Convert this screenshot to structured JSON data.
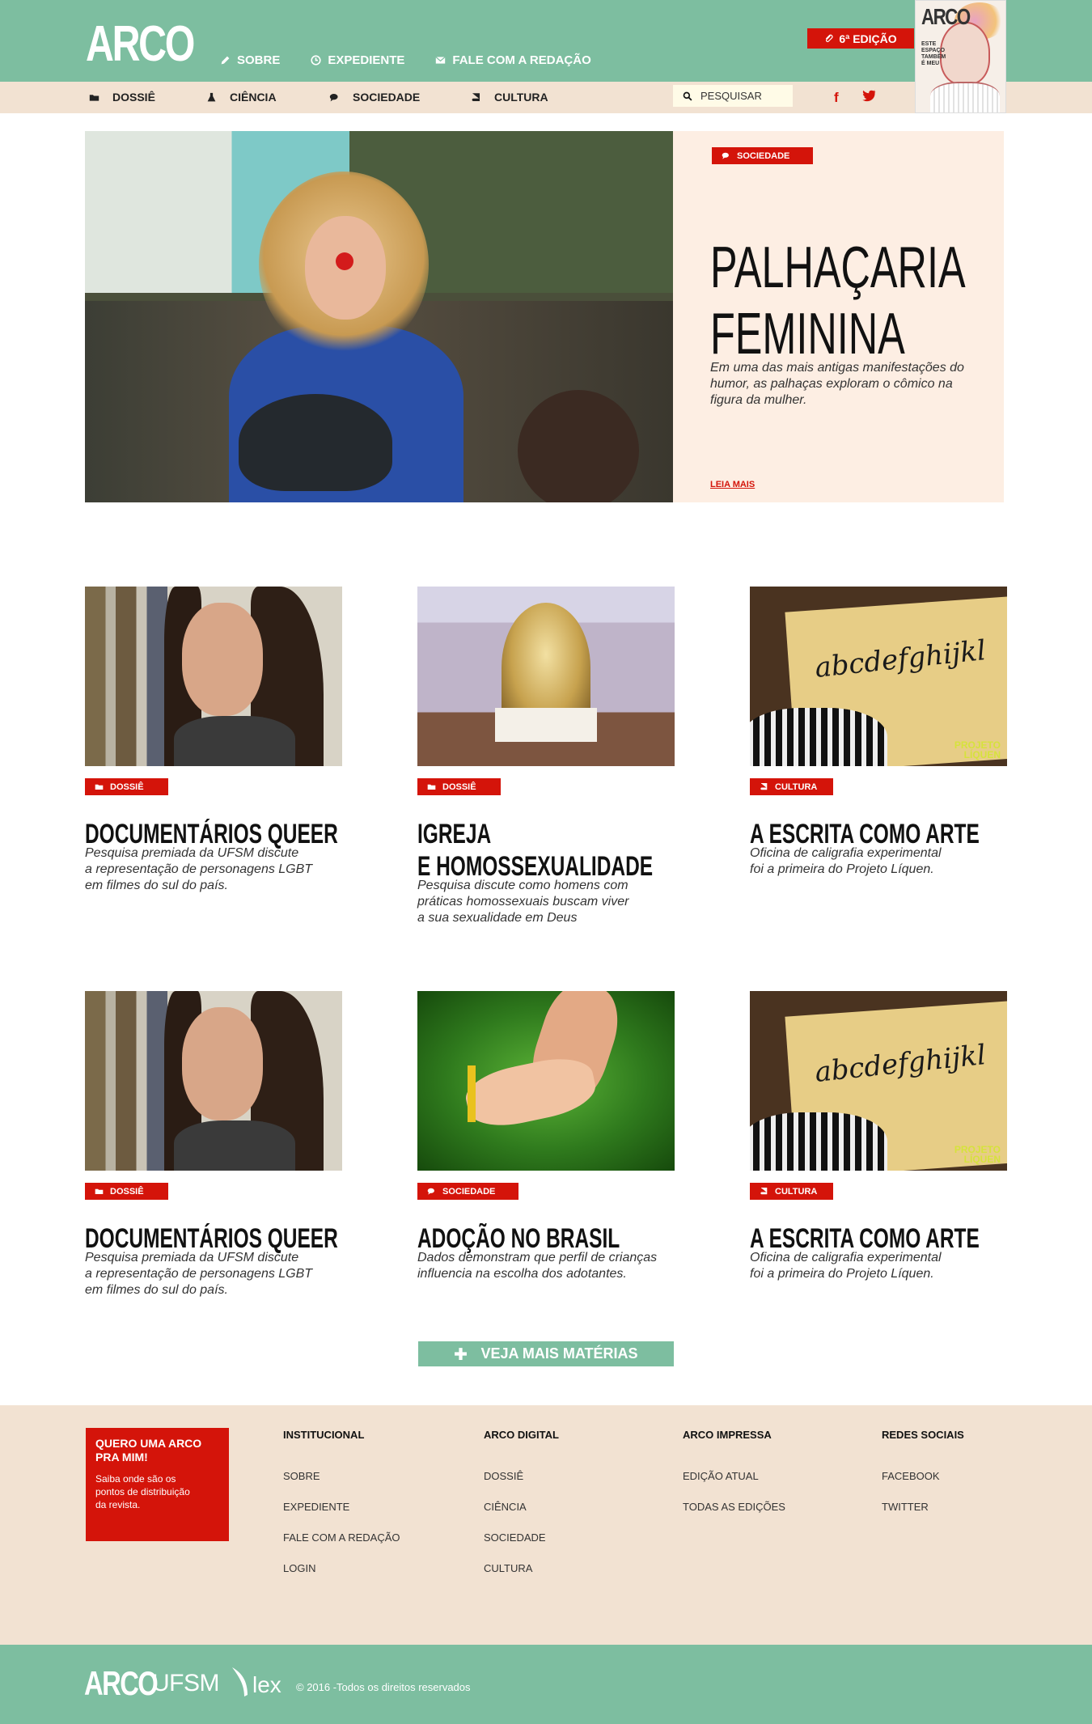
{
  "header": {
    "logo": "ARCO",
    "nav": [
      {
        "label": "SOBRE",
        "icon": "pencil-icon"
      },
      {
        "label": "EXPEDIENTE",
        "icon": "clock-icon"
      },
      {
        "label": "FALE COM A REDAÇÃO",
        "icon": "envelope-icon"
      }
    ],
    "edition_label": "6ª EDIÇÃO",
    "cover": {
      "title": "ARCO",
      "tagline": "ESTE ESPAÇO TAMBÉM É MEU"
    }
  },
  "categories": [
    {
      "label": "DOSSIÊ",
      "icon": "folder-icon"
    },
    {
      "label": "CIÊNCIA",
      "icon": "flask-icon"
    },
    {
      "label": "SOCIEDADE",
      "icon": "comments-icon"
    },
    {
      "label": "CULTURA",
      "icon": "book-icon"
    }
  ],
  "search": {
    "placeholder": "PESQUISAR"
  },
  "social_top": {
    "facebook": "f",
    "twitter": "t"
  },
  "hero": {
    "tag": "SOCIEDADE",
    "title": "PALHAÇARIA\nFEMININA",
    "description": "Em uma das mais antigas manifestações do humor, as palhaças exploram o cômico na figura da mulher.",
    "read_more": "LEIA MAIS"
  },
  "cards": [
    {
      "tag": "DOSSIÊ",
      "title": "DOCUMENTÁRIOS QUEER",
      "description": "Pesquisa premiada da UFSM discute\na representação de personagens LGBT\nem filmes do sul do país."
    },
    {
      "tag": "DOSSIÊ",
      "title": "IGREJA\nE HOMOSSEXUALIDADE",
      "description": "Pesquisa discute como homens com\npráticas homossexuais buscam viver\na sua sexualidade em Deus"
    },
    {
      "tag": "CULTURA",
      "title": "A ESCRITA COMO ARTE",
      "description": "Oficina de caligrafia experimental\nfoi a primeira do Projeto Líquen."
    },
    {
      "tag": "DOSSIÊ",
      "title": "DOCUMENTÁRIOS QUEER",
      "description": "Pesquisa premiada da UFSM discute\na representação de personagens LGBT\nem filmes do sul do país."
    },
    {
      "tag": "SOCIEDADE",
      "title": "ADOÇÃO NO BRASIL",
      "description": "Dados demonstram que perfil de crianças\ninfluencia na escolha dos adotantes."
    },
    {
      "tag": "CULTURA",
      "title": "A ESCRITA COMO ARTE",
      "description": "Oficina de caligrafia experimental\nfoi a primeira do Projeto Líquen."
    }
  ],
  "calligraphy_brand": "PROJETO\nLÍQUEN",
  "more_button": "VEJA MAIS MATÉRIAS",
  "footer": {
    "promo": {
      "title": "QUERO UMA ARCO\nPRA MIM!",
      "text": "Saiba onde são os\npontos de distribuição\nda revista."
    },
    "columns": [
      {
        "heading": "INSTITUCIONAL",
        "links": [
          "SOBRE",
          "EXPEDIENTE",
          "FALE COM A REDAÇÃO",
          "LOGIN"
        ]
      },
      {
        "heading": "ARCO DIGITAL",
        "links": [
          "DOSSIÊ",
          "CIÊNCIA",
          "SOCIEDADE",
          "CULTURA"
        ]
      },
      {
        "heading": "ARCO IMPRESSA",
        "links": [
          "EDIÇÃO ATUAL",
          "TODAS AS EDIÇÕES"
        ]
      },
      {
        "heading": "REDES SOCIAIS",
        "links": [
          "FACEBOOK",
          "TWITTER"
        ]
      }
    ]
  },
  "bottom": {
    "logo": "ARCO",
    "ufsm": "UFSM",
    "lex": "lex",
    "copyright": "© 2016 -Todos os direitos reservados"
  },
  "colors": {
    "green": "#7dbea0",
    "red": "#d4140a",
    "beige": "#f2e2d2"
  }
}
